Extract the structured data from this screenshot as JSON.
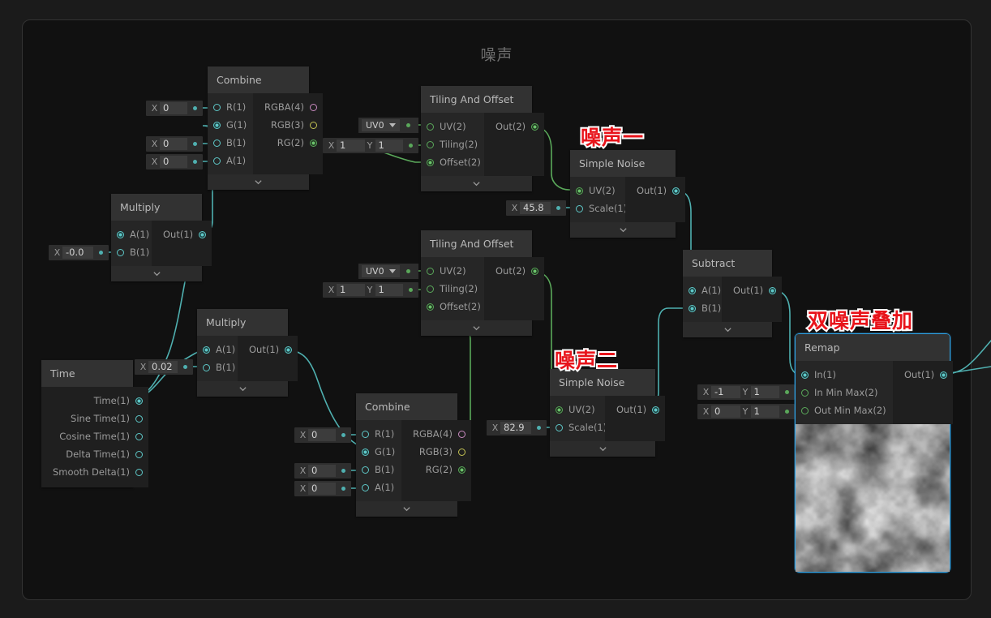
{
  "graph": {
    "title": "噪声",
    "background_color": "#111111",
    "accent_select_color": "#2f9fe0"
  },
  "annotations": [
    {
      "id": "anno-noise-one",
      "text": "噪声一",
      "color": "#e8131a"
    },
    {
      "id": "anno-noise-two",
      "text": "噪声二",
      "color": "#e8131a"
    },
    {
      "id": "anno-dual-noise",
      "text": "双噪声叠加",
      "color": "#e8131a"
    }
  ],
  "nodes": {
    "combine_top": {
      "title": "Combine",
      "inputs": [
        "R(1)",
        "G(1)",
        "B(1)",
        "A(1)"
      ],
      "outputs": [
        "RGBA(4)",
        "RGB(3)",
        "RG(2)"
      ],
      "fields": [
        {
          "axis": "X",
          "value": "0"
        },
        {
          "axis": "X",
          "value": "0"
        },
        {
          "axis": "X",
          "value": "0"
        }
      ]
    },
    "multiply_top": {
      "title": "Multiply",
      "inputs": [
        "A(1)",
        "B(1)"
      ],
      "outputs": [
        "Out(1)"
      ],
      "fields": [
        {
          "axis": "X",
          "value": "-0.0"
        }
      ]
    },
    "multiply_bottom": {
      "title": "Multiply",
      "inputs": [
        "A(1)",
        "B(1)"
      ],
      "outputs": [
        "Out(1)"
      ],
      "fields": [
        {
          "axis": "X",
          "value": "0.02"
        }
      ]
    },
    "time": {
      "title": "Time",
      "outputs": [
        "Time(1)",
        "Sine Time(1)",
        "Cosine Time(1)",
        "Delta Time(1)",
        "Smooth Delta(1)"
      ]
    },
    "tiling_offset_top": {
      "title": "Tiling And Offset",
      "inputs": [
        "UV(2)",
        "Tiling(2)",
        "Offset(2)"
      ],
      "outputs": [
        "Out(2)"
      ],
      "uv_channel": "UV0",
      "tiling": {
        "x_axis": "X",
        "x": "1",
        "y_axis": "Y",
        "y": "1"
      }
    },
    "tiling_offset_bottom": {
      "title": "Tiling And Offset",
      "inputs": [
        "UV(2)",
        "Tiling(2)",
        "Offset(2)"
      ],
      "outputs": [
        "Out(2)"
      ],
      "uv_channel": "UV0",
      "tiling": {
        "x_axis": "X",
        "x": "1",
        "y_axis": "Y",
        "y": "1"
      }
    },
    "simple_noise_one": {
      "title": "Simple Noise",
      "inputs": [
        "UV(2)",
        "Scale(1)"
      ],
      "outputs": [
        "Out(1)"
      ],
      "scale": {
        "axis": "X",
        "value": "45.8"
      }
    },
    "simple_noise_two": {
      "title": "Simple Noise",
      "inputs": [
        "UV(2)",
        "Scale(1)"
      ],
      "outputs": [
        "Out(1)"
      ],
      "scale": {
        "axis": "X",
        "value": "82.9"
      }
    },
    "combine_bottom": {
      "title": "Combine",
      "inputs": [
        "R(1)",
        "G(1)",
        "B(1)",
        "A(1)"
      ],
      "outputs": [
        "RGBA(4)",
        "RGB(3)",
        "RG(2)"
      ],
      "fields": [
        {
          "axis": "X",
          "value": "0"
        },
        {
          "axis": "X",
          "value": "0"
        },
        {
          "axis": "X",
          "value": "0"
        }
      ]
    },
    "subtract": {
      "title": "Subtract",
      "inputs": [
        "A(1)",
        "B(1)"
      ],
      "outputs": [
        "Out(1)"
      ]
    },
    "remap": {
      "title": "Remap",
      "inputs": [
        "In(1)",
        "In Min Max(2)",
        "Out Min Max(2)"
      ],
      "outputs": [
        "Out(1)"
      ],
      "selected": true,
      "in_min_max": {
        "x_axis": "X",
        "x": "-1",
        "y_axis": "Y",
        "y": "1"
      },
      "out_min_max": {
        "x_axis": "X",
        "x": "0",
        "y_axis": "Y",
        "y": "1"
      },
      "preview": "simple-noise-grayscale"
    }
  }
}
